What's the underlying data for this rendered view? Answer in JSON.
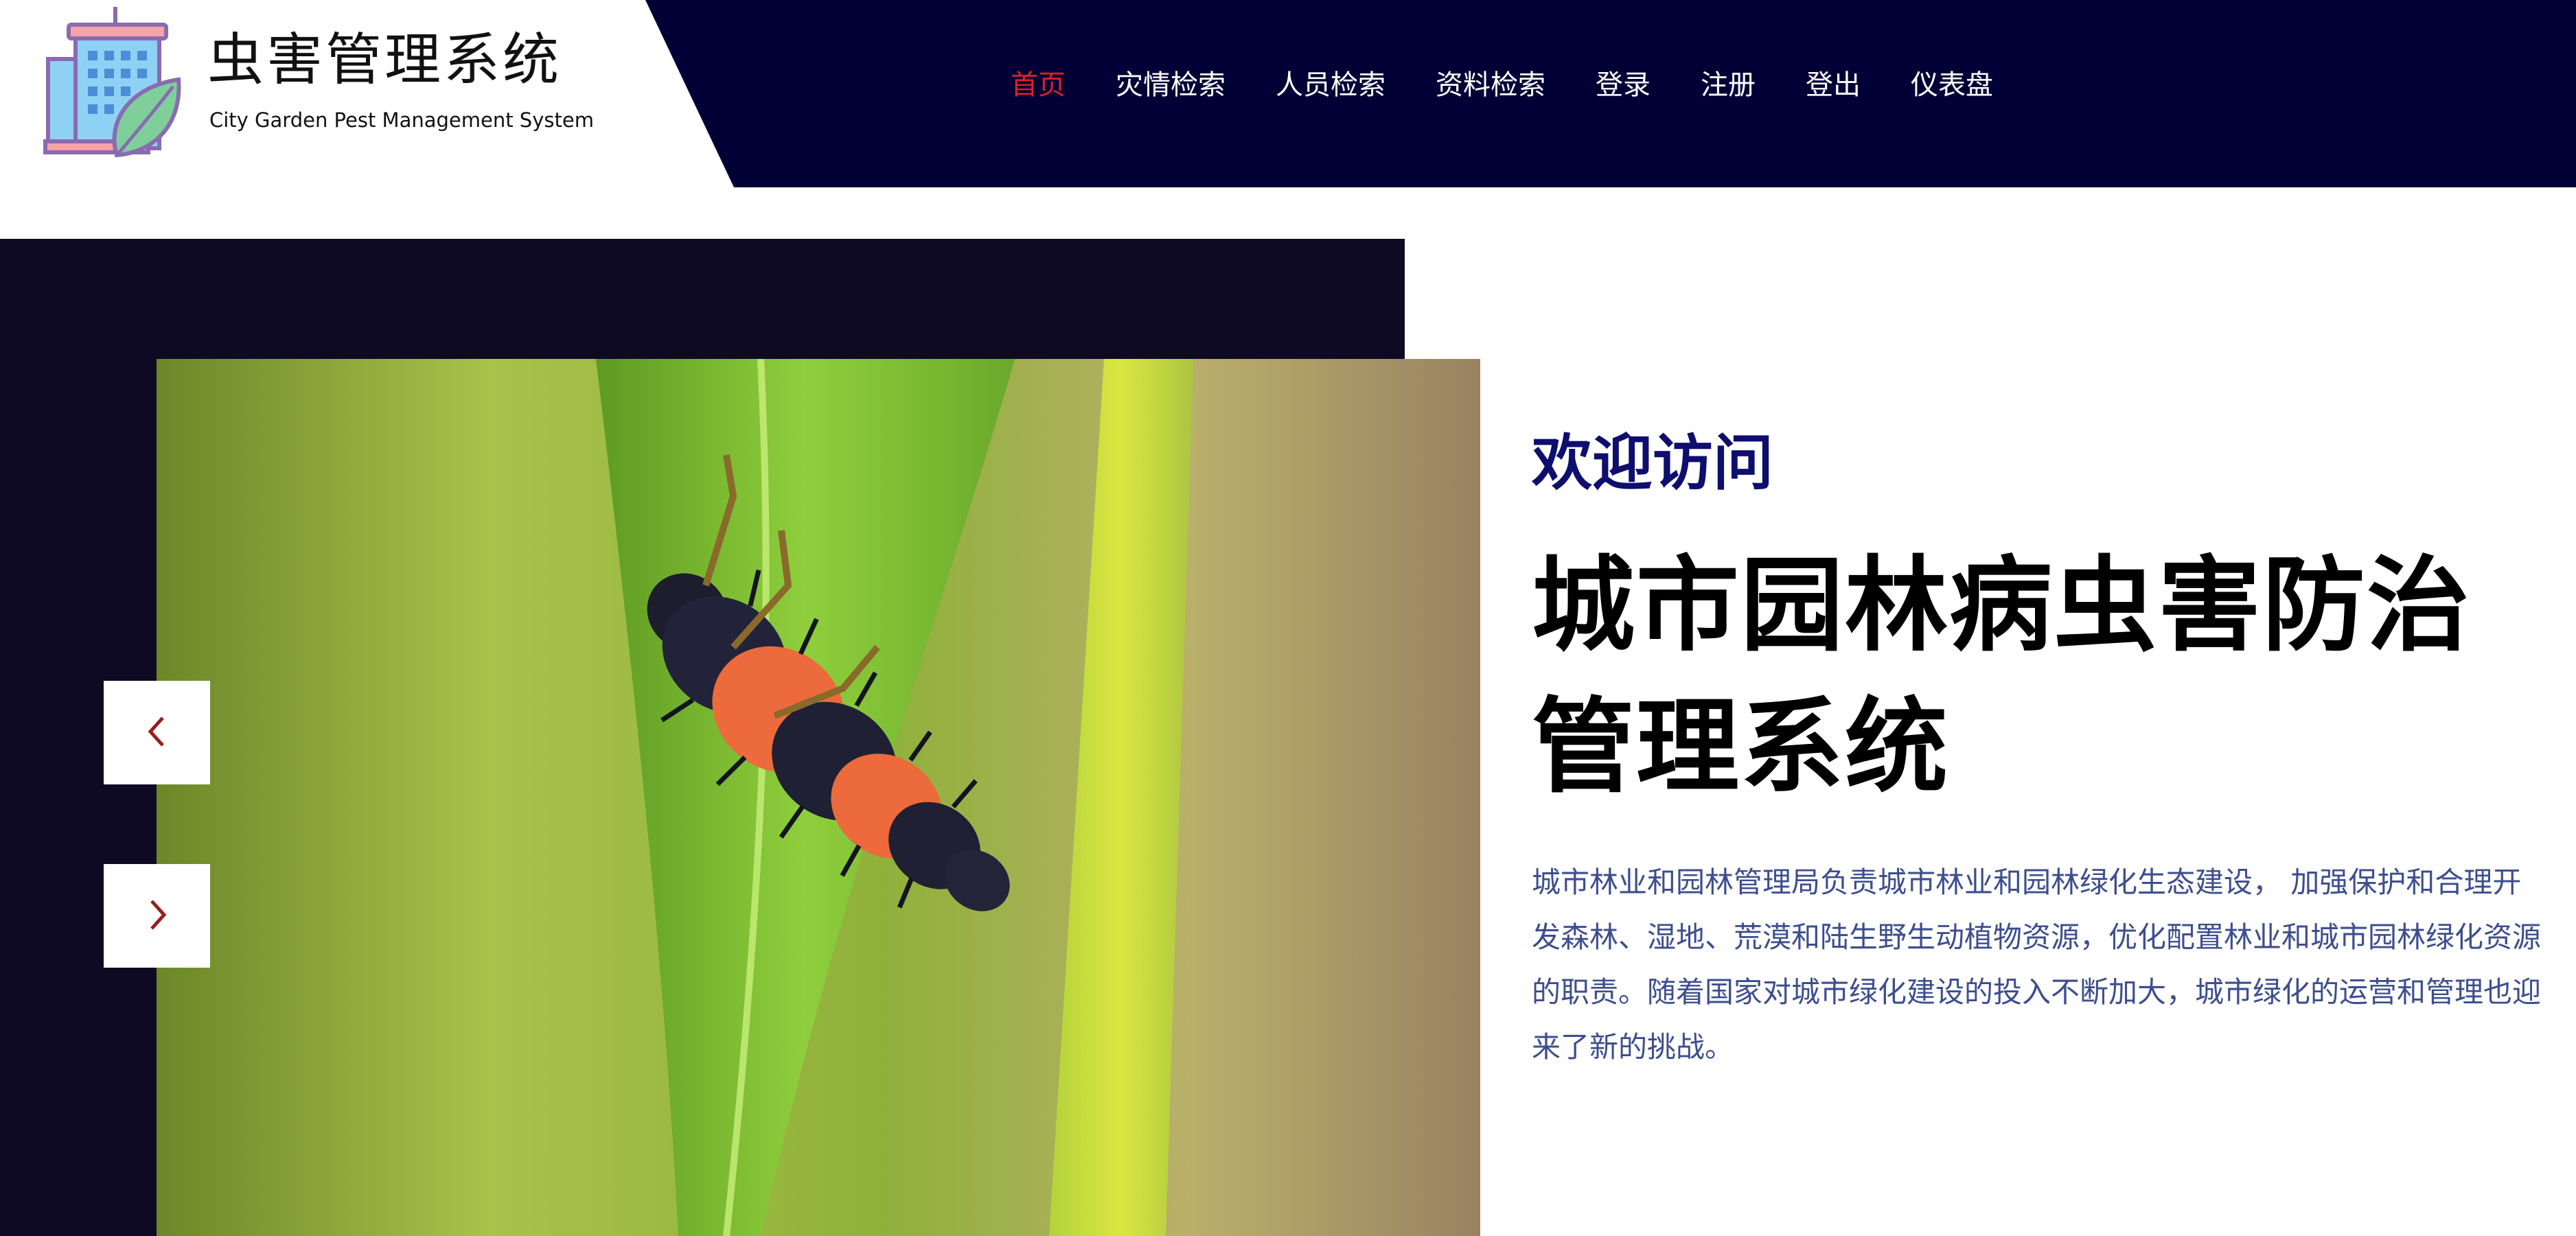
{
  "header": {
    "logo_title": "虫害管理系统",
    "logo_subtitle": "City Garden Pest Management System",
    "logo_icon": "building-leaf-icon",
    "nav": [
      {
        "label": "首页",
        "active": true
      },
      {
        "label": "灾情检索",
        "active": false
      },
      {
        "label": "人员检索",
        "active": false
      },
      {
        "label": "资料检索",
        "active": false
      },
      {
        "label": "登录",
        "active": false
      },
      {
        "label": "注册",
        "active": false
      },
      {
        "label": "登出",
        "active": false
      },
      {
        "label": "仪表盘",
        "active": false
      }
    ]
  },
  "hero": {
    "image": "ladybug-larva-on-leaf-photo",
    "prev_icon": "chevron-left-icon",
    "next_icon": "chevron-right-icon"
  },
  "intro": {
    "welcome": "欢迎访问",
    "title": "城市园林病虫害防治管理系统",
    "description": "城市林业和园林管理局负责城市林业和园林绿化生态建设， 加强保护和合理开发森林、湿地、荒漠和陆生野生动植物资源，优化配置林业和城市园林绿化资源的职责。随着国家对城市绿化建设的投入不断加大，城市绿化的运营和管理也迎来了新的挑战。"
  },
  "colors": {
    "nav_background": "#000037",
    "nav_active": "#e01e28",
    "hero_dark": "#0e0a24",
    "welcome": "#0e0e6e",
    "description": "#3d4e8e",
    "arrow": "#9b1c1c"
  }
}
